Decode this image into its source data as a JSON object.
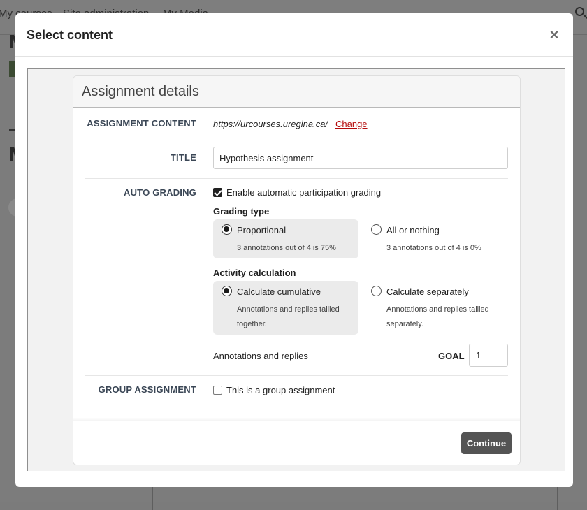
{
  "background": {
    "nav_links": [
      "My courses",
      "Site administration",
      "My Media"
    ],
    "heading_initials": [
      "M",
      "M"
    ]
  },
  "modal": {
    "title": "Select content",
    "close_glyph": "×"
  },
  "assignment": {
    "header": "Assignment details",
    "content": {
      "label": "ASSIGNMENT CONTENT",
      "url": "https://urcourses.uregina.ca/",
      "change_label": "Change"
    },
    "title_field": {
      "label": "TITLE",
      "value": "Hypothesis assignment"
    },
    "auto_grading": {
      "label": "AUTO GRADING",
      "enable_label": "Enable automatic participation grading",
      "enabled": true,
      "grading_type": {
        "heading": "Grading type",
        "options": [
          {
            "label": "Proportional",
            "help": "3 annotations out of 4 is 75%",
            "selected": true
          },
          {
            "label": "All or nothing",
            "help": "3 annotations out of 4 is 0%",
            "selected": false
          }
        ]
      },
      "activity_calculation": {
        "heading": "Activity calculation",
        "options": [
          {
            "label": "Calculate cumulative",
            "help": "Annotations and replies tallied together.",
            "selected": true
          },
          {
            "label": "Calculate separately",
            "help": "Annotations and replies tallied separately.",
            "selected": false
          }
        ]
      },
      "annotations_label": "Annotations and replies",
      "goal_label": "GOAL",
      "goal_value": "1"
    },
    "group": {
      "label": "GROUP ASSIGNMENT",
      "checkbox_label": "This is a group assignment",
      "checked": false
    },
    "continue_label": "Continue"
  },
  "icons": {
    "close": "close-icon",
    "search": "search-icon"
  }
}
